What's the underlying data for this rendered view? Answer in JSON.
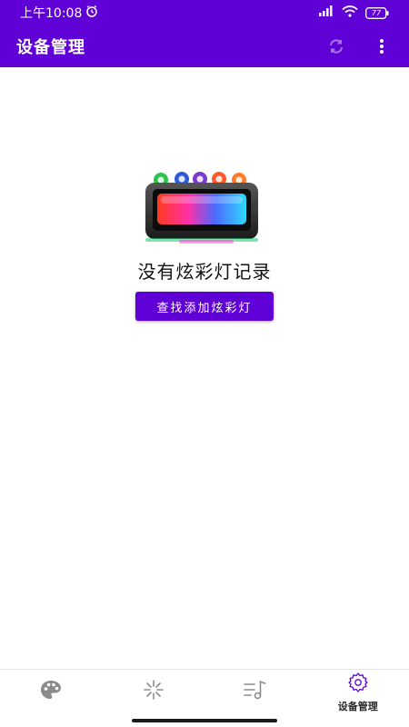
{
  "status_bar": {
    "time": "上午10:08",
    "battery": "77"
  },
  "app_bar": {
    "title": "设备管理",
    "icons": [
      "sync-icon",
      "more-vert-icon"
    ]
  },
  "main": {
    "empty_message": "没有炫彩灯记录",
    "add_button_label": "查找添加炫彩灯"
  },
  "bottom_nav": {
    "items": [
      {
        "icon": "palette-icon",
        "label": ""
      },
      {
        "icon": "sparkle-icon",
        "label": ""
      },
      {
        "icon": "music-list-icon",
        "label": ""
      },
      {
        "icon": "gear-icon",
        "label": "设备管理"
      }
    ]
  },
  "colors": {
    "primary": "#5e00d6",
    "background": "#ffffff"
  }
}
